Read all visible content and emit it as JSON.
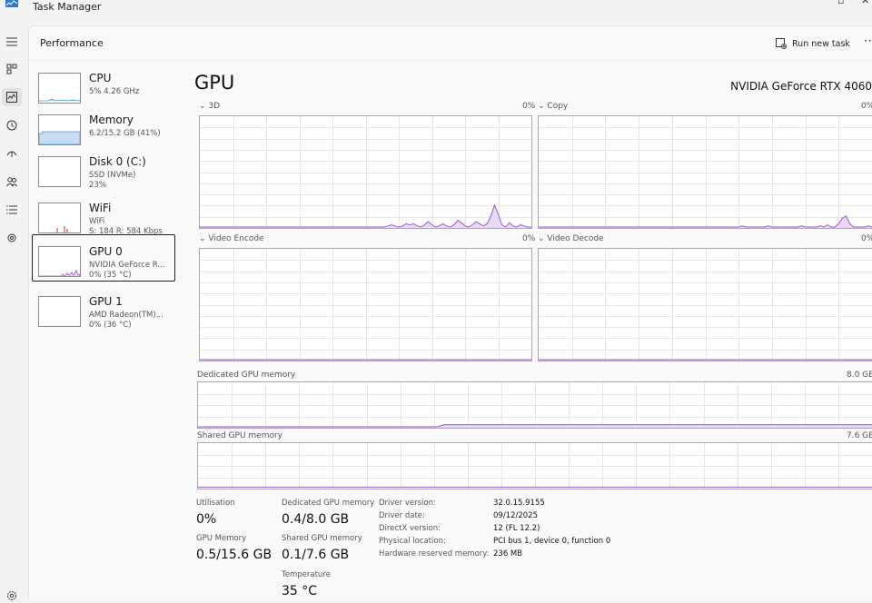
{
  "window": {
    "title": "Task Manager"
  },
  "header": {
    "title": "Performance",
    "run_new_task": "Run new task",
    "more": "···"
  },
  "rail": {
    "icons": [
      "hamburger-menu-icon",
      "processes-icon",
      "performance-icon",
      "app-history-icon",
      "startup-apps-icon",
      "users-icon",
      "details-icon",
      "services-icon",
      "settings-icon"
    ]
  },
  "colors": {
    "accent_purple": "#9b59d0",
    "purple_fill": "#e8d9f5",
    "memory_blue": "#4a90d9",
    "memory_fill": "#c8ddf3",
    "grid": "#e6e6e6",
    "wifi_red": "#c0392b"
  },
  "sidebar": {
    "items": [
      {
        "name": "CPU",
        "sub1": "5%  4.26 GHz",
        "sub2": ""
      },
      {
        "name": "Memory",
        "sub1": "6.2/15.2 GB (41%)",
        "sub2": ""
      },
      {
        "name": "Disk 0 (C:)",
        "sub1": "SSD (NVMe)",
        "sub2": "23%"
      },
      {
        "name": "WiFi",
        "sub1": "WiFi",
        "sub2": "S: 184  R: 584 Kbps"
      },
      {
        "name": "GPU 0",
        "sub1": "NVIDIA GeForce R...",
        "sub2": "0%  (35 °C)"
      },
      {
        "name": "GPU 1",
        "sub1": "AMD Radeon(TM)...",
        "sub2": "0%  (36 °C)"
      }
    ]
  },
  "gpu": {
    "title": "GPU",
    "device_name": "NVIDIA GeForce RTX 4060",
    "engines": [
      {
        "label": "3D",
        "value": "0%"
      },
      {
        "label": "Copy",
        "value": "0%"
      },
      {
        "label": "Video Encode",
        "value": "0%"
      },
      {
        "label": "Video Decode",
        "value": "0%"
      }
    ],
    "dedicated_memory": {
      "label": "Dedicated GPU memory",
      "max": "8.0 GB"
    },
    "shared_memory": {
      "label": "Shared GPU memory",
      "max": "7.6 GB"
    }
  },
  "chart_data": [
    {
      "type": "area",
      "series": [
        {
          "name": "3D",
          "values": [
            0,
            0,
            0,
            0,
            0,
            0,
            0,
            0,
            0,
            0,
            0,
            0,
            0,
            0,
            0,
            0,
            0,
            0,
            0,
            0,
            0,
            0,
            0,
            0,
            0,
            0,
            0,
            0,
            0,
            0,
            0,
            0,
            0,
            0,
            0,
            0,
            0,
            0,
            0,
            0,
            0,
            0,
            0,
            0,
            0,
            0,
            0,
            0,
            0,
            0,
            0,
            1,
            2,
            1,
            0,
            1,
            3,
            2,
            3,
            1,
            0,
            2,
            5,
            2,
            0,
            1,
            3,
            1,
            0,
            2,
            6,
            4,
            1,
            0,
            2,
            5,
            3,
            1,
            3,
            10,
            20,
            12,
            2,
            0,
            4,
            1,
            0,
            2,
            1,
            0,
            0
          ]
        }
      ],
      "ylim": [
        0,
        100
      ]
    },
    {
      "type": "area",
      "series": [
        {
          "name": "Copy",
          "values": [
            0,
            0,
            0,
            0,
            0,
            0,
            0,
            0,
            0,
            0,
            0,
            0,
            0,
            0,
            0,
            0,
            0,
            0,
            0,
            0,
            0,
            0,
            0,
            0,
            0,
            0,
            0,
            0,
            0,
            0,
            0,
            0,
            0,
            0,
            0,
            0,
            0,
            0,
            0,
            0,
            0,
            0,
            0,
            0,
            0,
            0,
            0,
            0,
            0,
            0,
            0,
            0,
            0,
            0,
            0,
            1,
            0,
            0,
            0,
            0,
            0,
            0,
            1,
            0,
            0,
            0,
            0,
            0,
            0,
            0,
            0,
            1,
            0,
            0,
            0,
            0,
            1,
            0,
            2,
            0,
            0,
            3,
            8,
            10,
            3,
            0,
            0,
            0,
            0,
            1,
            0
          ]
        }
      ],
      "ylim": [
        0,
        100
      ]
    },
    {
      "type": "area",
      "series": [
        {
          "name": "Video Encode",
          "values": [
            0,
            0,
            0,
            0,
            0,
            0,
            0,
            0,
            0,
            0
          ]
        }
      ],
      "ylim": [
        0,
        100
      ]
    },
    {
      "type": "area",
      "series": [
        {
          "name": "Video Decode",
          "values": [
            0,
            0,
            0,
            0,
            0,
            0,
            0,
            0,
            0,
            0
          ]
        }
      ],
      "ylim": [
        0,
        100
      ]
    },
    {
      "type": "line",
      "series": [
        {
          "name": "Dedicated GPU memory",
          "values": [
            0,
            0,
            0,
            0,
            0,
            0,
            0,
            0,
            0,
            0,
            0,
            0,
            0,
            0,
            0,
            0,
            0,
            0,
            0,
            0,
            0,
            0,
            0,
            0,
            0,
            0,
            0,
            0,
            0,
            0,
            0,
            0,
            0,
            0,
            0.4,
            0.4,
            0.4,
            0.4,
            0.4,
            0.4,
            0.4,
            0.4,
            0.4,
            0.4,
            0.4,
            0.4,
            0.4,
            0.4,
            0.4,
            0.4,
            0.4,
            0.4,
            0.4,
            0.4,
            0.4,
            0.4,
            0.4,
            0.4,
            0.4,
            0.4,
            0.4,
            0.4,
            0.4,
            0.4,
            0.4,
            0.4,
            0.4,
            0.4,
            0.4,
            0.4,
            0.4,
            0.4,
            0.4,
            0.4,
            0.4,
            0.4,
            0.4,
            0.4,
            0.4,
            0.4,
            0.4,
            0.4,
            0.4,
            0.4,
            0.4,
            0.4,
            0.4,
            0.4,
            0.4,
            0.4,
            0.4,
            0.4,
            0.4,
            0.4
          ]
        }
      ],
      "ylim": [
        0,
        8.0
      ]
    },
    {
      "type": "line",
      "series": [
        {
          "name": "Shared GPU memory",
          "values": [
            0.1,
            0.1,
            0.1,
            0.1,
            0.1,
            0.1,
            0.1,
            0.1,
            0.1,
            0.1
          ]
        }
      ],
      "ylim": [
        0,
        7.6
      ]
    }
  ],
  "stats": {
    "utilisation": {
      "label": "Utilisation",
      "value": "0%"
    },
    "gpu_memory": {
      "label": "GPU Memory",
      "value": "0.5/15.6 GB"
    },
    "dedicated": {
      "label": "Dedicated GPU memory",
      "value": "0.4/8.0 GB"
    },
    "shared": {
      "label": "Shared GPU memory",
      "value": "0.1/7.6 GB"
    },
    "temperature": {
      "label": "Temperature",
      "value": "35 °C"
    },
    "details": [
      {
        "label": "Driver version:",
        "value": "32.0.15.9155"
      },
      {
        "label": "Driver date:",
        "value": "09/12/2025"
      },
      {
        "label": "DirectX version:",
        "value": "12 (FL 12.2)"
      },
      {
        "label": "Physical location:",
        "value": "PCI bus 1, device 0, function 0"
      },
      {
        "label": "Hardware reserved memory:",
        "value": "236 MB"
      }
    ]
  }
}
